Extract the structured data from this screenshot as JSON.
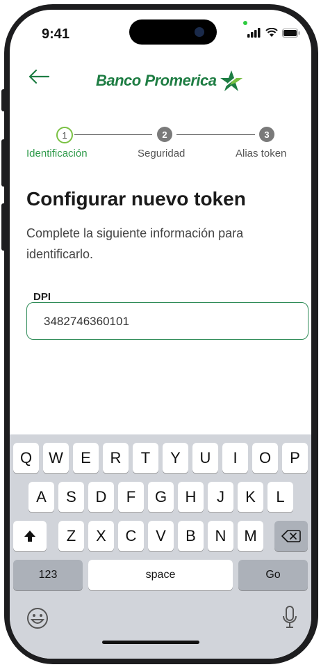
{
  "status": {
    "time": "9:41"
  },
  "header": {
    "brand": "Banco Promerica"
  },
  "stepper": {
    "steps": [
      {
        "number": "1",
        "label": "Identificación"
      },
      {
        "number": "2",
        "label": "Seguridad"
      },
      {
        "number": "3",
        "label": "Alias token"
      }
    ]
  },
  "main": {
    "title": "Configurar nuevo token",
    "subtitle": "Complete la siguiente información para identificarlo.",
    "dpi_label": "DPI",
    "dpi_value": "3482746360101"
  },
  "keyboard": {
    "row1": [
      "Q",
      "W",
      "E",
      "R",
      "T",
      "Y",
      "U",
      "I",
      "O",
      "P"
    ],
    "row2": [
      "A",
      "S",
      "D",
      "F",
      "G",
      "H",
      "J",
      "K",
      "L"
    ],
    "row3": [
      "Z",
      "X",
      "C",
      "V",
      "B",
      "N",
      "M"
    ],
    "numbers_key": "123",
    "space_key": "space",
    "go_key": "Go"
  },
  "colors": {
    "brand_green": "#1e7d43",
    "accent_green": "#7ac143",
    "field_border": "#2e8b57"
  }
}
